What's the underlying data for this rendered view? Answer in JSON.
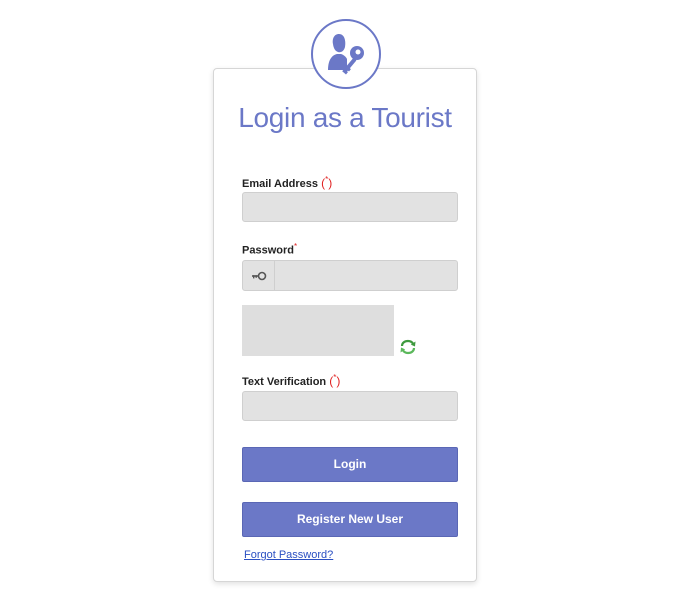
{
  "header": {
    "icon": "user-key-icon",
    "title": "Login as a Tourist"
  },
  "form": {
    "email": {
      "label": "Email Address",
      "required_open": "(",
      "required_mark": "*",
      "required_close": ")",
      "value": "",
      "placeholder": ""
    },
    "password": {
      "label": "Password",
      "required_mark": "*",
      "addon_icon": "key-icon",
      "value": "",
      "placeholder": ""
    },
    "captcha": {
      "image": "captcha-image",
      "refresh_icon": "refresh-icon"
    },
    "verification": {
      "label": "Text Verification",
      "required_open": "(",
      "required_mark": "*",
      "required_close": ")",
      "value": "",
      "placeholder": ""
    },
    "login_label": "Login",
    "register_label": "Register New User",
    "forgot_label": "Forgot Password?"
  },
  "colors": {
    "accent": "#6b78c7",
    "required": "#e02020",
    "link": "#2a4fc2",
    "field_bg": "#e2e2e2"
  }
}
